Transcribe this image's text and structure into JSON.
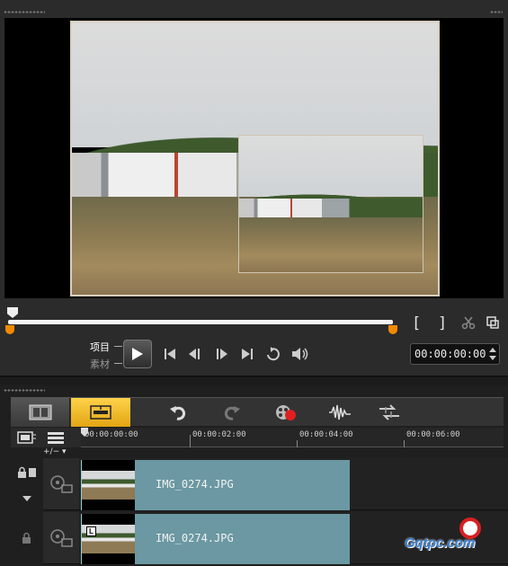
{
  "player": {
    "mode_project": "项目",
    "mode_clip": "素材",
    "timecode": "00:00:00:00",
    "mark_in": "[",
    "mark_out": "]",
    "playback_progress": 0
  },
  "timeline": {
    "zoom_label": "+/− ▾",
    "ruler": [
      "00:00:00:00",
      "00:00:02:00",
      "00:00:04:00",
      "00:00:06:00"
    ],
    "tracks": [
      {
        "clip_name": "IMG_0274.JPG"
      },
      {
        "clip_name": "IMG_0274.JPG"
      }
    ]
  },
  "watermark": {
    "text": "Gqtpc.com"
  },
  "colors": {
    "accent": "#f08a00",
    "timeline_view_active": "#ffd24a",
    "clip": "#6b98a2",
    "watermark": "#3b7fd0"
  }
}
